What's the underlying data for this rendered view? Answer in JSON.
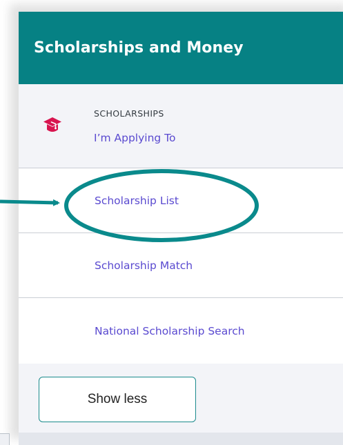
{
  "panel": {
    "title": "Scholarships and Money"
  },
  "section": {
    "icon": "graduation-cap-icon",
    "eyebrow": "SCHOLARSHIPS",
    "link": "I’m Applying To"
  },
  "links": [
    {
      "label": "Scholarship List"
    },
    {
      "label": "Scholarship Match"
    },
    {
      "label": "National Scholarship Search"
    }
  ],
  "footer": {
    "show_less_label": "Show less"
  },
  "colors": {
    "header_bg": "#068184",
    "link": "#5a4ad0",
    "icon": "#d8154f",
    "annotation": "#0a8a8c"
  }
}
